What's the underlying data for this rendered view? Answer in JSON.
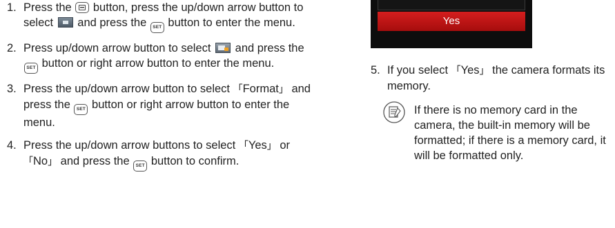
{
  "steps": [
    {
      "num": "1.",
      "t1": "Press the ",
      "t2": " button, press the up/down arrow button to select ",
      "t3": " and press the ",
      "t4": " button to enter the menu."
    },
    {
      "num": "2.",
      "t1": "Press up/down arrow button to select ",
      "t2": " and press the ",
      "t3": " button or right arrow button to enter the menu."
    },
    {
      "num": "3.",
      "t1": "Press the up/down arrow button to select ",
      "q_open": "「",
      "option": "Format",
      "q_close": "」",
      "t2": " and press the ",
      "t3": " button or right arrow button to enter the menu."
    },
    {
      "num": "4.",
      "t1": "Press the up/down arrow buttons to select ",
      "q1_open": "「",
      "opt_yes": "Yes",
      "q1_close": "」",
      "t_or": " or ",
      "q2_open": "「",
      "opt_no": "No",
      "q2_close": "」",
      "t2": " and press the ",
      "t3": " button to confirm."
    }
  ],
  "set_button_label": "SET",
  "screen": {
    "selected_option": "Yes"
  },
  "step5": {
    "num": "5.",
    "t1": "If you select ",
    "q_open": "「",
    "option": "Yes",
    "q_close": "」",
    "t2": " the camera formats its memory."
  },
  "note": {
    "text": "If there is no memory card in the camera, the built-in memory will be formatted; if there is a memory card, it will be formatted only."
  },
  "colors": {
    "highlight_red": "#c81414",
    "screen_bg": "#0d0d0d"
  },
  "icons": [
    "menu-button-icon",
    "playback-mode-icon",
    "set-button-icon",
    "setup-menu-icon",
    "note-icon"
  ]
}
